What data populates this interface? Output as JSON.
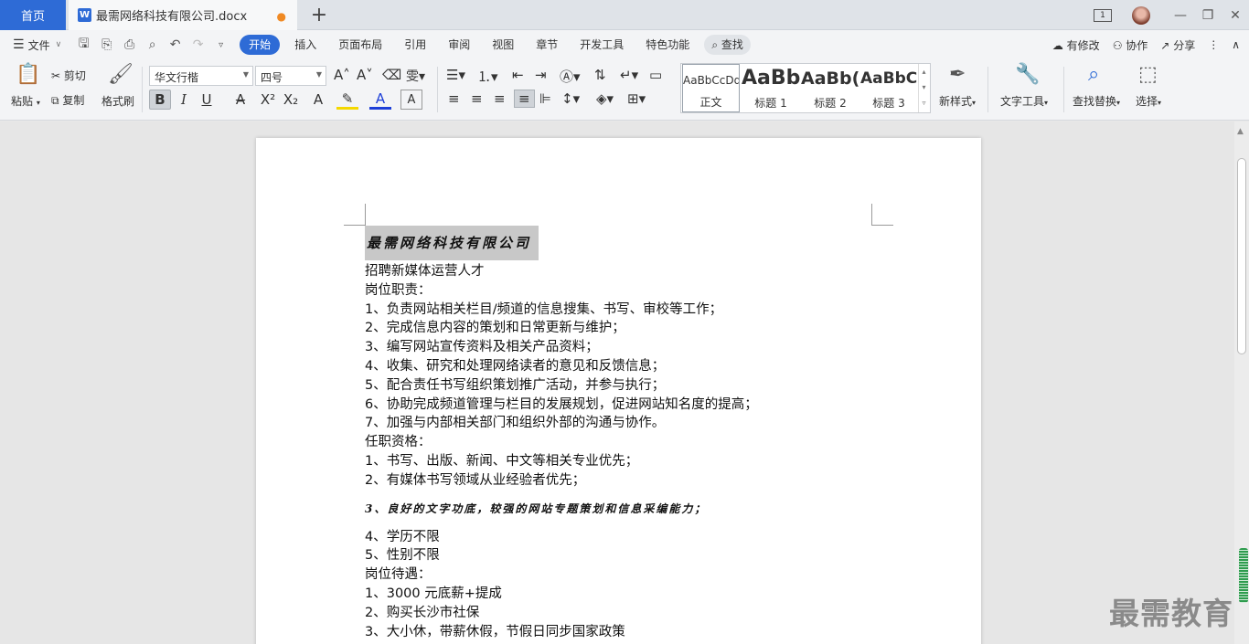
{
  "tabs": {
    "home_label": "首页",
    "doc_label": "最需网络科技有限公司.docx",
    "doc_icon_letter": "W",
    "add_label": "+",
    "window_counter": "1"
  },
  "menu": {
    "file_label": "文件",
    "items": [
      "开始",
      "插入",
      "页面布局",
      "引用",
      "审阅",
      "视图",
      "章节",
      "开发工具",
      "特色功能"
    ],
    "search_label": "查找",
    "right": [
      "有修改",
      "协作",
      "分享"
    ]
  },
  "ribbon": {
    "paste": "粘贴",
    "cut": "剪切",
    "copy": "复制",
    "format_painter": "格式刷",
    "font_name": "华文行楷",
    "font_size": "四号",
    "styles": [
      {
        "sample": "AaBbCcDd",
        "label": "正文"
      },
      {
        "sample": "AaBb",
        "label": "标题 1"
      },
      {
        "sample": "AaBb(",
        "label": "标题 2"
      },
      {
        "sample": "AaBbC",
        "label": "标题 3"
      }
    ],
    "new_style": "新样式",
    "text_tools": "文字工具",
    "find_replace": "查找替换",
    "select": "选择"
  },
  "document": {
    "title": "最需网络科技有限公司",
    "lines": [
      "招聘新媒体运营人才",
      "岗位职责：",
      "1、负责网站相关栏目/频道的信息搜集、书写、审校等工作；",
      "2、完成信息内容的策划和日常更新与维护；",
      "3、编写网站宣传资料及相关产品资料；",
      "4、收集、研究和处理网络读者的意见和反馈信息；",
      "5、配合责任书写组织策划推广活动，并参与执行；",
      "6、协助完成频道管理与栏目的发展规划，促进网站知名度的提高；",
      "7、加强与内部相关部门和组织外部的沟通与协作。",
      "任职资格：",
      "1、书写、出版、新闻、中文等相关专业优先；",
      "2、有媒体书写领域从业经验者优先；"
    ],
    "special_line": "3、良好的文字功底，较强的网站专题策划和信息采编能力；",
    "lines_after": [
      "4、学历不限",
      "5、性别不限",
      "岗位待遇：",
      "1、3000 元底薪+提成",
      "2、购买长沙市社保",
      "3、大小休，带薪休假，节假日同步国家政策"
    ]
  },
  "watermark": "最需教育"
}
